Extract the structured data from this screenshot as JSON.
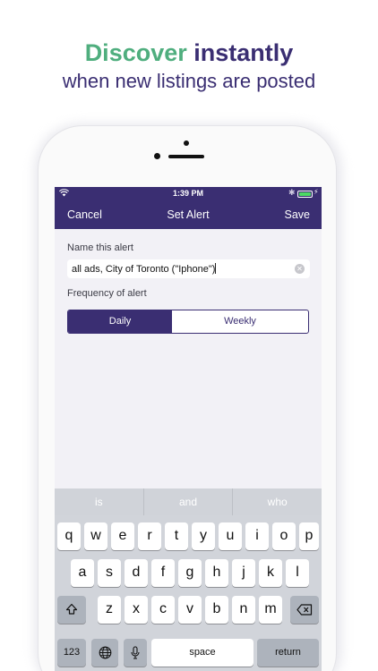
{
  "headline": {
    "part1": "Discover",
    "part2": "instantly",
    "subline": "when new listings are posted"
  },
  "status_bar": {
    "time": "1:39 PM"
  },
  "nav": {
    "cancel": "Cancel",
    "title": "Set Alert",
    "save": "Save"
  },
  "form": {
    "name_label": "Name this alert",
    "name_value": "all ads, City of Toronto (\"Iphone\")",
    "frequency_label": "Frequency of alert",
    "frequency_options": [
      "Daily",
      "Weekly"
    ],
    "frequency_selected": "Daily"
  },
  "keyboard": {
    "predictions": [
      "is",
      "and",
      "who"
    ],
    "row1": [
      "q",
      "w",
      "e",
      "r",
      "t",
      "y",
      "u",
      "i",
      "o",
      "p"
    ],
    "row2": [
      "a",
      "s",
      "d",
      "f",
      "g",
      "h",
      "j",
      "k",
      "l"
    ],
    "row3": [
      "z",
      "x",
      "c",
      "v",
      "b",
      "n",
      "m"
    ],
    "numbers_key": "123",
    "space_key": "space",
    "return_key": "return"
  },
  "colors": {
    "brand_purple": "#3a2e72",
    "brand_green": "#4fae7e"
  },
  "icons": [
    "wifi-icon",
    "bluetooth-icon",
    "battery-icon",
    "clear-icon",
    "shift-icon",
    "backspace-icon",
    "globe-icon",
    "microphone-icon"
  ]
}
